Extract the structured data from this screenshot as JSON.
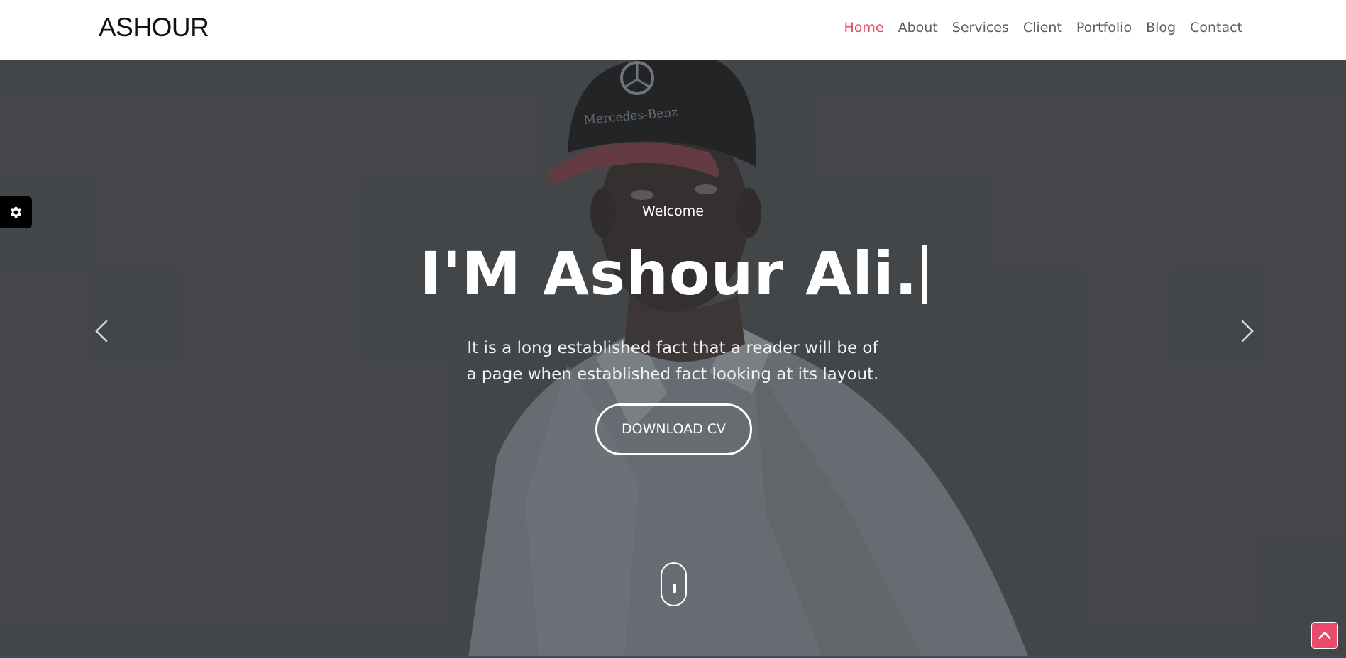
{
  "brand": "ASHOUR",
  "nav": {
    "items": [
      {
        "label": "Home",
        "active": true
      },
      {
        "label": "About",
        "active": false
      },
      {
        "label": "Services",
        "active": false
      },
      {
        "label": "Client",
        "active": false
      },
      {
        "label": "Portfolio",
        "active": false
      },
      {
        "label": "Blog",
        "active": false
      },
      {
        "label": "Contact",
        "active": false
      }
    ]
  },
  "hero": {
    "welcome": "Welcome",
    "title": "I'M Ashour Ali.",
    "description_line1": "It is a long established fact that a reader will be of",
    "description_line2": "a page when established fact looking at its layout.",
    "cta_label": "DOWNLOAD CV",
    "background_image": "man-in-black-cap-and-light-shirt"
  },
  "icons": {
    "settings": "gear-icon",
    "prev": "chevron-left-icon",
    "next": "chevron-right-icon",
    "scroll_indicator": "mouse-icon",
    "scroll_top": "chevron-up-icon"
  },
  "colors": {
    "accent": "#e84b6c",
    "hero_overlay": "#484a4e",
    "nav_text": "#5e5e5e",
    "brand_text": "#111111"
  }
}
